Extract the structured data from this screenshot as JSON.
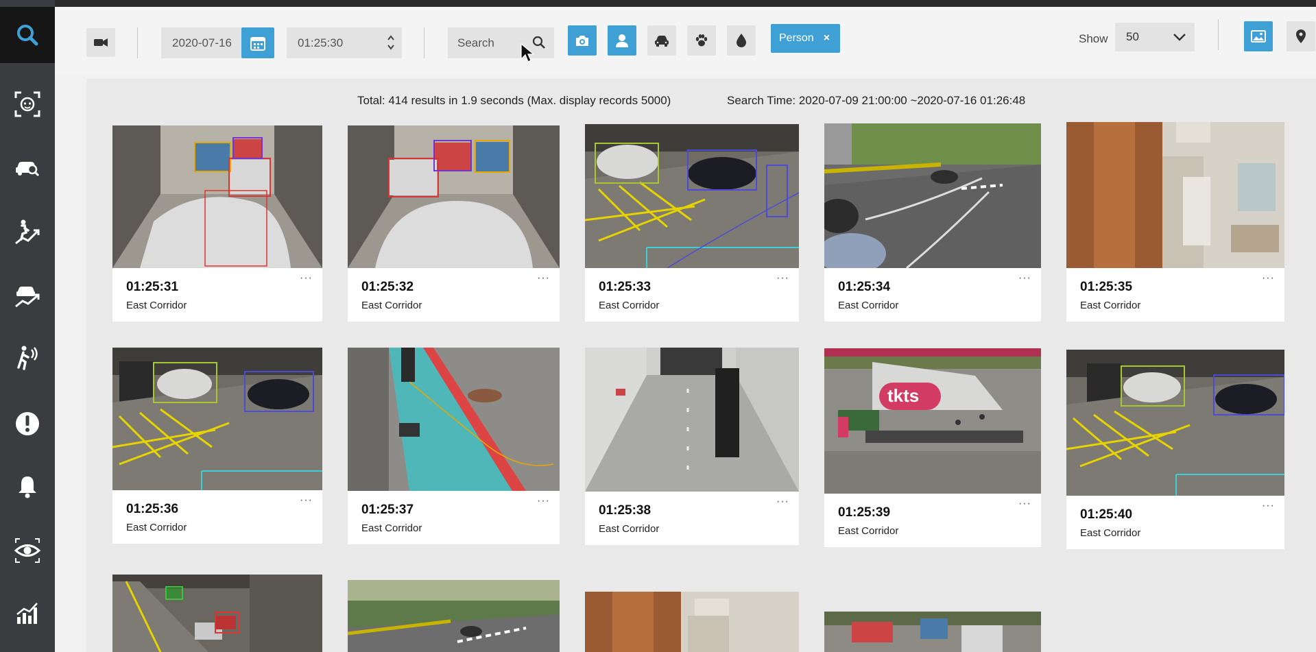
{
  "toolbar": {
    "date": "2020-07-16",
    "time": "01:25:30",
    "search_placeholder": "Search",
    "filter_tag": "Person",
    "filter_tag_close": "×",
    "show_label": "Show",
    "show_value": "50"
  },
  "summary": {
    "total": "Total: 414 results in 1.9 seconds (Max. display records 5000)",
    "search_time": "Search Time: 2020-07-09 21:00:00 ~2020-07-16 01:26:48"
  },
  "results": [
    {
      "time": "01:25:31",
      "location": "East Corridor"
    },
    {
      "time": "01:25:32",
      "location": "East Corridor"
    },
    {
      "time": "01:25:33",
      "location": "East Corridor"
    },
    {
      "time": "01:25:34",
      "location": "East Corridor"
    },
    {
      "time": "01:25:35",
      "location": "East Corridor"
    },
    {
      "time": "01:25:36",
      "location": "East Corridor"
    },
    {
      "time": "01:25:37",
      "location": "East Corridor"
    },
    {
      "time": "01:25:38",
      "location": "East Corridor"
    },
    {
      "time": "01:25:39",
      "location": "East Corridor"
    },
    {
      "time": "01:25:40",
      "location": "East Corridor"
    }
  ],
  "thumb_labels": {
    "tkts_sign": "tkts"
  },
  "more_glyph": "···",
  "icons": {
    "sidebar": [
      "search-icon",
      "face-recognition-icon",
      "vehicle-search-icon",
      "person-trajectory-icon",
      "vehicle-trajectory-icon",
      "person-activity-icon",
      "alert-icon",
      "bell-icon",
      "eye-icon",
      "statistics-icon"
    ],
    "toolbar": [
      "video-camera-icon",
      "calendar-icon",
      "stepper-icon",
      "magnifier-icon",
      "camera-icon",
      "person-icon",
      "car-icon",
      "paw-icon",
      "drop-icon",
      "chevron-down-icon",
      "image-view-icon",
      "map-pin-icon"
    ]
  },
  "colors": {
    "accent": "#3fa0d6",
    "sidebar": "#3a3c3f",
    "sidebar_active": "#161616",
    "search_icon": "#3fa0d6"
  }
}
